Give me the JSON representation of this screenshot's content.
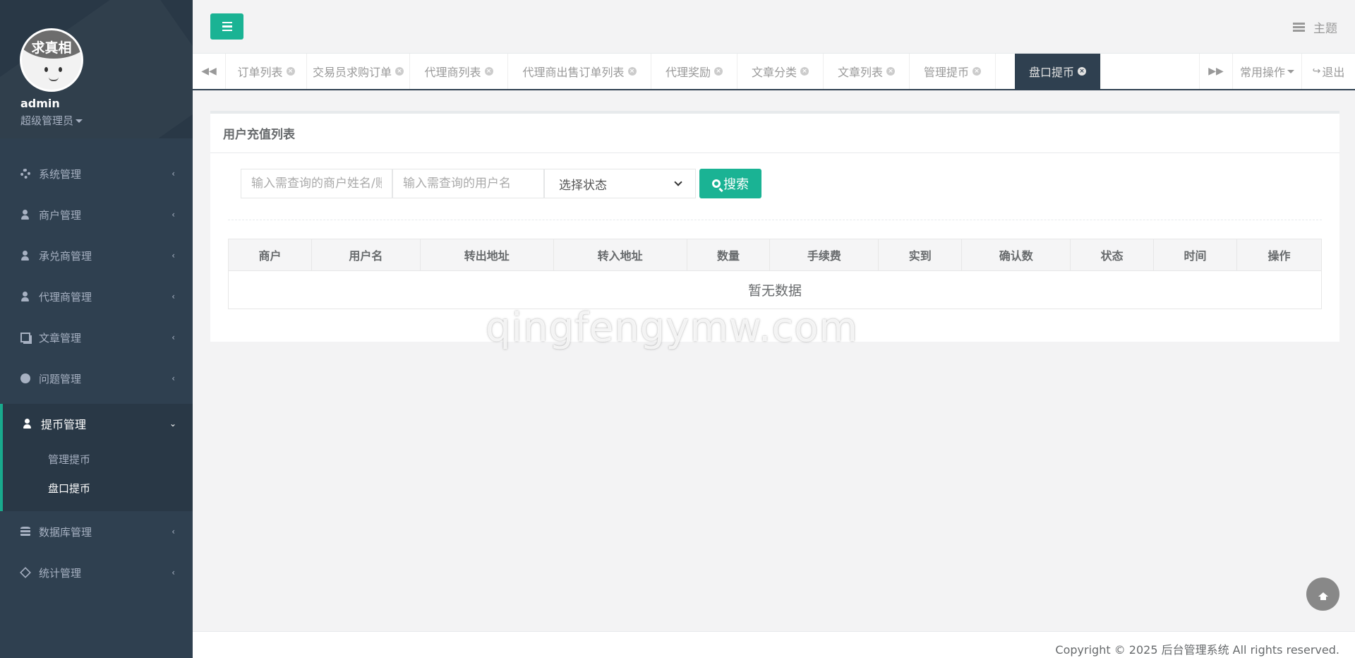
{
  "profile": {
    "avatar_text": "求真相",
    "name": "admin",
    "role": "超级管理员"
  },
  "sidebar": {
    "items": [
      {
        "label": "系统管理",
        "icon": "gear-icon"
      },
      {
        "label": "商户管理",
        "icon": "user-icon"
      },
      {
        "label": "承兑商管理",
        "icon": "user-icon"
      },
      {
        "label": "代理商管理",
        "icon": "user-icon"
      },
      {
        "label": "文章管理",
        "icon": "copy-icon"
      },
      {
        "label": "问题管理",
        "icon": "comment-icon"
      },
      {
        "label": "提币管理",
        "icon": "user-icon",
        "expanded": true
      },
      {
        "label": "数据库管理",
        "icon": "database-icon"
      },
      {
        "label": "统计管理",
        "icon": "cube-icon"
      }
    ],
    "sub_items": [
      {
        "label": "管理提币"
      },
      {
        "label": "盘口提币",
        "selected": true
      }
    ]
  },
  "header": {
    "theme_label": "主题"
  },
  "tabs": {
    "items": [
      {
        "label": "订单列表"
      },
      {
        "label": "交易员求购订单"
      },
      {
        "label": "代理商列表"
      },
      {
        "label": "代理商出售订单列表"
      },
      {
        "label": "代理奖励"
      },
      {
        "label": "文章分类"
      },
      {
        "label": "文章列表"
      },
      {
        "label": "管理提币"
      },
      {
        "label": "盘口提币",
        "active": true
      }
    ],
    "common_ops": "常用操作",
    "logout": "退出"
  },
  "main": {
    "title": "用户充值列表",
    "search": {
      "merchant_placeholder": "输入需查询的商户姓名/账号",
      "user_placeholder": "输入需查询的用户名",
      "status_selected": "选择状态",
      "button_label": "搜索"
    },
    "table": {
      "columns": [
        "商户",
        "用户名",
        "转出地址",
        "转入地址",
        "数量",
        "手续费",
        "实到",
        "确认数",
        "状态",
        "时间",
        "操作"
      ],
      "empty_text": "暂无数据"
    }
  },
  "watermark": "qingfengymw.com",
  "footer": {
    "copyright": "Copyright © 2025 后台管理系统 All rights reserved."
  },
  "colors": {
    "sidebar_bg": "#2f4050",
    "accent": "#1ab394",
    "active_tab": "#2f4050"
  }
}
